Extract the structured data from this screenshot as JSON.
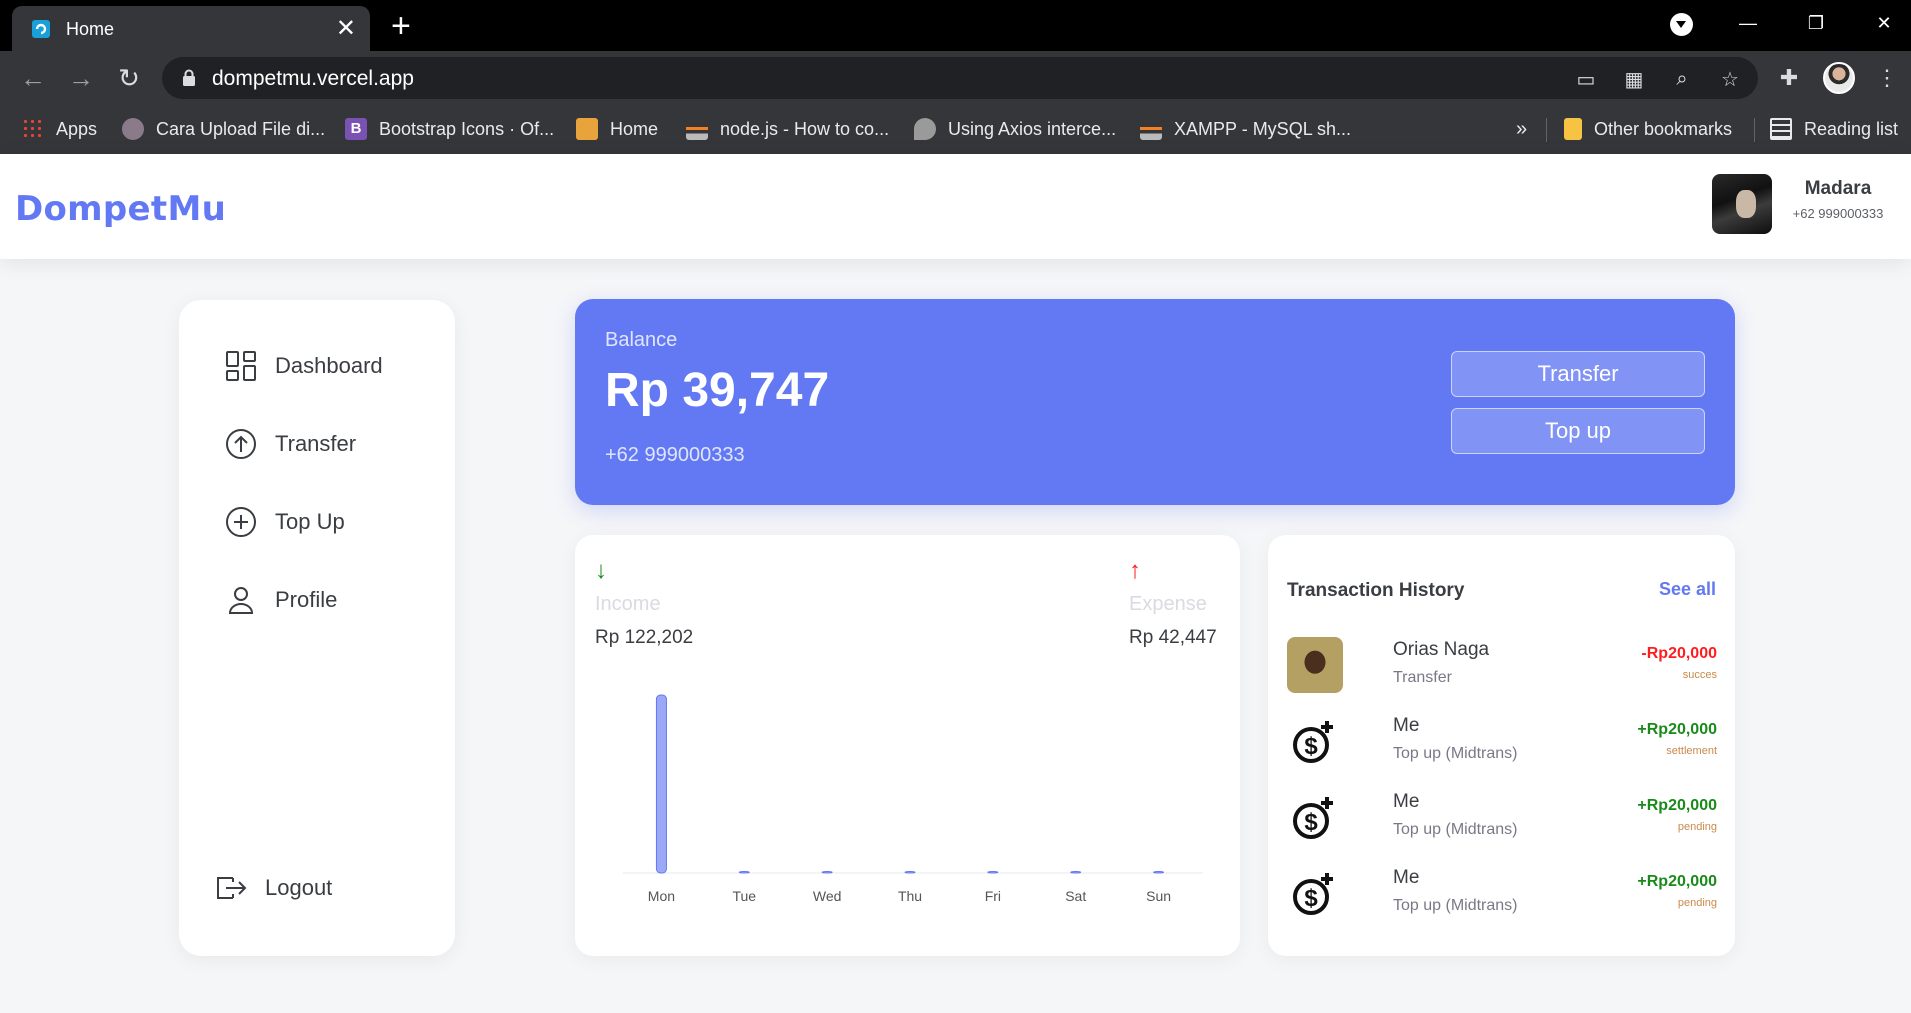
{
  "browser": {
    "tab_title": "Home",
    "url": "dompetmu.vercel.app",
    "bookmarks": [
      {
        "label": "Apps",
        "icon": "apps-grid-icon"
      },
      {
        "label": "Cara Upload File di...",
        "icon": "avatar-favicon-icon"
      },
      {
        "label": "Bootstrap Icons · Of...",
        "icon": "bootstrap-icon"
      },
      {
        "label": "Home",
        "icon": "box-icon"
      },
      {
        "label": "node.js - How to co...",
        "icon": "stackoverflow-icon"
      },
      {
        "label": "Using Axios interce...",
        "icon": "leaf-icon"
      },
      {
        "label": "XAMPP - MySQL sh...",
        "icon": "stackoverflow-icon"
      }
    ],
    "more_bookmarks": "»",
    "other_bookmarks": "Other bookmarks",
    "reading_list": "Reading list"
  },
  "app": {
    "brand": "DompetMu",
    "user": {
      "name": "Madara",
      "phone": "+62 999000333"
    },
    "sidebar": {
      "items": [
        {
          "label": "Dashboard",
          "icon": "dashboard-icon"
        },
        {
          "label": "Transfer",
          "icon": "arrow-up-circle-icon"
        },
        {
          "label": "Top Up",
          "icon": "plus-circle-icon"
        },
        {
          "label": "Profile",
          "icon": "person-icon"
        }
      ],
      "logout": "Logout"
    },
    "balance": {
      "label": "Balance",
      "value": "Rp 39,747",
      "phone": "+62 999000333",
      "transfer_button": "Transfer",
      "topup_button": "Top up"
    },
    "stats": {
      "income_label": "Income",
      "income_value": "Rp 122,202",
      "expense_label": "Expense",
      "expense_value": "Rp 42,447",
      "income_arrow": "↓",
      "expense_arrow": "↑"
    },
    "history": {
      "title": "Transaction History",
      "see_all": "See all",
      "items": [
        {
          "name": "Orias Naga",
          "type": "Transfer",
          "amount": "-Rp20,000",
          "status": "succes",
          "amount_color": "#ff1e1e",
          "avatar": "photo"
        },
        {
          "name": "Me",
          "type": "Top up (Midtrans)",
          "amount": "+Rp20,000",
          "status": "settlement",
          "amount_color": "#1a8a1a",
          "avatar": "dollar-plus-icon"
        },
        {
          "name": "Me",
          "type": "Top up (Midtrans)",
          "amount": "+Rp20,000",
          "status": "pending",
          "amount_color": "#1a8a1a",
          "avatar": "dollar-plus-icon"
        },
        {
          "name": "Me",
          "type": "Top up (Midtrans)",
          "amount": "+Rp20,000",
          "status": "pending",
          "amount_color": "#1a8a1a",
          "avatar": "dollar-plus-icon"
        }
      ]
    }
  },
  "chart_data": {
    "type": "bar",
    "categories": [
      "Mon",
      "Tue",
      "Wed",
      "Thu",
      "Fri",
      "Sat",
      "Sun"
    ],
    "values": [
      122202,
      0,
      0,
      0,
      0,
      0,
      0
    ],
    "title": "",
    "xlabel": "",
    "ylabel": "",
    "grid": false,
    "bar_color": "#9aa8f7"
  }
}
